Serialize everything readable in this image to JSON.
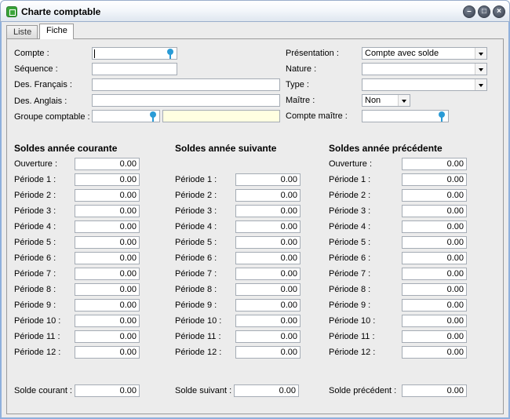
{
  "window": {
    "title": "Charte comptable",
    "min": "–",
    "max": "□",
    "close": "×"
  },
  "tabs": [
    {
      "label": "Liste"
    },
    {
      "label": "Fiche"
    }
  ],
  "form": {
    "compte": {
      "label": "Compte :",
      "value": ""
    },
    "sequence": {
      "label": "Séquence :",
      "value": ""
    },
    "des_fr": {
      "label": "Des. Français :",
      "value": ""
    },
    "des_en": {
      "label": "Des. Anglais :",
      "value": ""
    },
    "groupe": {
      "label": "Groupe comptable :",
      "value": "",
      "desc": ""
    },
    "presentation": {
      "label": "Présentation :",
      "value": "Compte avec solde"
    },
    "nature": {
      "label": "Nature :",
      "value": ""
    },
    "type": {
      "label": "Type :",
      "value": ""
    },
    "maitre": {
      "label": "Maître :",
      "value": "Non"
    },
    "compte_maitre": {
      "label": "Compte maître :",
      "value": ""
    }
  },
  "balances": {
    "courante": {
      "title": "Soldes année courante",
      "ouverture": {
        "label": "Ouverture :",
        "value": "0.00"
      },
      "periods": [
        {
          "label": "Période 1 :",
          "value": "0.00"
        },
        {
          "label": "Période 2 :",
          "value": "0.00"
        },
        {
          "label": "Période 3 :",
          "value": "0.00"
        },
        {
          "label": "Période 4 :",
          "value": "0.00"
        },
        {
          "label": "Période 5 :",
          "value": "0.00"
        },
        {
          "label": "Période 6 :",
          "value": "0.00"
        },
        {
          "label": "Période 7 :",
          "value": "0.00"
        },
        {
          "label": "Période 8 :",
          "value": "0.00"
        },
        {
          "label": "Période 9 :",
          "value": "0.00"
        },
        {
          "label": "Période 10 :",
          "value": "0.00"
        },
        {
          "label": "Période 11 :",
          "value": "0.00"
        },
        {
          "label": "Période 12 :",
          "value": "0.00"
        }
      ],
      "total": {
        "label": "Solde courant :",
        "value": "0.00"
      }
    },
    "suivante": {
      "title": "Soldes année suivante",
      "periods": [
        {
          "label": "Période 1 :",
          "value": "0.00"
        },
        {
          "label": "Période 2 :",
          "value": "0.00"
        },
        {
          "label": "Période 3 :",
          "value": "0.00"
        },
        {
          "label": "Période 4 :",
          "value": "0.00"
        },
        {
          "label": "Période 5 :",
          "value": "0.00"
        },
        {
          "label": "Période 6 :",
          "value": "0.00"
        },
        {
          "label": "Période 7 :",
          "value": "0.00"
        },
        {
          "label": "Période 8 :",
          "value": "0.00"
        },
        {
          "label": "Période 9 :",
          "value": "0.00"
        },
        {
          "label": "Période 10 :",
          "value": "0.00"
        },
        {
          "label": "Période 11 :",
          "value": "0.00"
        },
        {
          "label": "Période 12 :",
          "value": "0.00"
        }
      ],
      "total": {
        "label": "Solde suivant :",
        "value": "0.00"
      }
    },
    "precedente": {
      "title": "Soldes année précédente",
      "ouverture": {
        "label": "Ouverture :",
        "value": "0.00"
      },
      "periods": [
        {
          "label": "Période 1 :",
          "value": "0.00"
        },
        {
          "label": "Période 2 :",
          "value": "0.00"
        },
        {
          "label": "Période 3 :",
          "value": "0.00"
        },
        {
          "label": "Période 4 :",
          "value": "0.00"
        },
        {
          "label": "Période 5 :",
          "value": "0.00"
        },
        {
          "label": "Période 6 :",
          "value": "0.00"
        },
        {
          "label": "Période 7 :",
          "value": "0.00"
        },
        {
          "label": "Période 8 :",
          "value": "0.00"
        },
        {
          "label": "Période 9 :",
          "value": "0.00"
        },
        {
          "label": "Période 10 :",
          "value": "0.00"
        },
        {
          "label": "Période 11 :",
          "value": "0.00"
        },
        {
          "label": "Période 12 :",
          "value": "0.00"
        }
      ],
      "total": {
        "label": "Solde précédent :",
        "value": "0.00"
      }
    }
  }
}
